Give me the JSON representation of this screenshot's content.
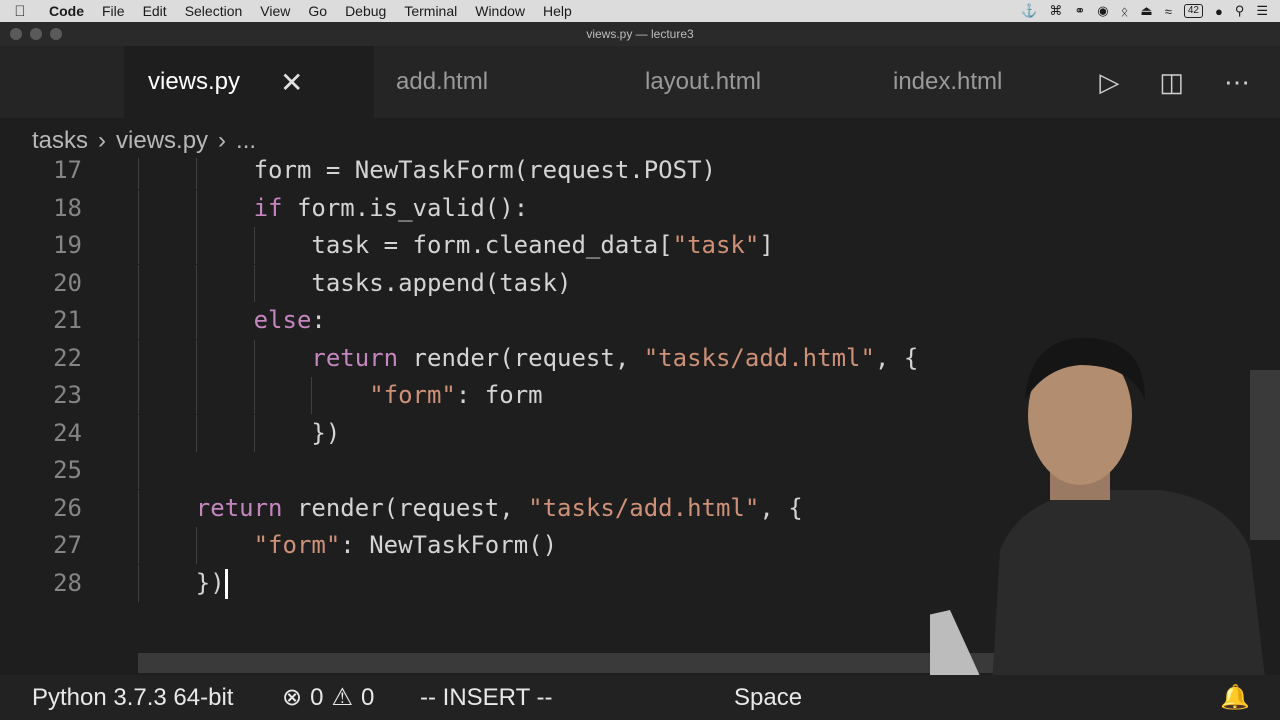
{
  "menubar": {
    "app": "Code",
    "items": [
      "File",
      "Edit",
      "Selection",
      "View",
      "Go",
      "Debug",
      "Terminal",
      "Window",
      "Help"
    ],
    "battery": "42"
  },
  "window": {
    "title": "views.py — lecture3"
  },
  "tabs": [
    {
      "label": "views.py",
      "active": true
    },
    {
      "label": "add.html"
    },
    {
      "label": "layout.html"
    },
    {
      "label": "index.html"
    }
  ],
  "breadcrumb": {
    "folder": "tasks",
    "file": "views.py",
    "more": "..."
  },
  "editor": {
    "lines": [
      {
        "n": "17",
        "code": "        form = NewTaskForm(request.POST)"
      },
      {
        "n": "18",
        "code": "        if form.is_valid():"
      },
      {
        "n": "19",
        "code": "            task = form.cleaned_data[\"task\"]"
      },
      {
        "n": "20",
        "code": "            tasks.append(task)"
      },
      {
        "n": "21",
        "code": "        else:"
      },
      {
        "n": "22",
        "code": "            return render(request, \"tasks/add.html\", {"
      },
      {
        "n": "23",
        "code": "                \"form\": form"
      },
      {
        "n": "24",
        "code": "            })"
      },
      {
        "n": "25",
        "code": ""
      },
      {
        "n": "26",
        "code": "    return render(request, \"tasks/add.html\", {"
      },
      {
        "n": "27",
        "code": "        \"form\": NewTaskForm()"
      },
      {
        "n": "28",
        "code": "    })"
      }
    ]
  },
  "statusbar": {
    "interpreter": "Python 3.7.3 64-bit",
    "errors": "0",
    "warnings": "0",
    "mode": "-- INSERT --",
    "spaces": "Space"
  },
  "colors": {
    "keyword": "#c586c0",
    "string": "#ce9178",
    "text": "#d4d4d4",
    "background": "#1e1e1e"
  }
}
